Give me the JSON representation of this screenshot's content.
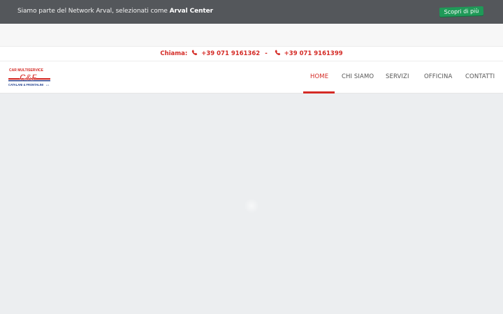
{
  "topbar": {
    "text_prefix": "Siamo parte del Network Arval, selezionati come ",
    "text_bold": "Arval Center",
    "button_label": "Scopri di più"
  },
  "contact": {
    "label": "Chiama:",
    "phone_1": "+39 071 9161362",
    "separator": "-",
    "phone_2": "+39 071 9161399"
  },
  "logo": {
    "line_top": "CAR MULTISERVICE",
    "mark": "C&F",
    "line_bottom": "CATALANI & FRONTALINI",
    "suffix": "s.r.l."
  },
  "nav": {
    "items": [
      {
        "label": "HOME"
      },
      {
        "label": "CHI SIAMO"
      },
      {
        "label": "SERVIZI"
      },
      {
        "label": "OFFICINA"
      },
      {
        "label": "CONTATTI"
      }
    ],
    "active_index": 0
  },
  "colors": {
    "brand_red": "#d42a25",
    "cta_green": "#1f9a58",
    "topbar_bg": "#54575b",
    "logo_blue": "#1f3f8f"
  }
}
